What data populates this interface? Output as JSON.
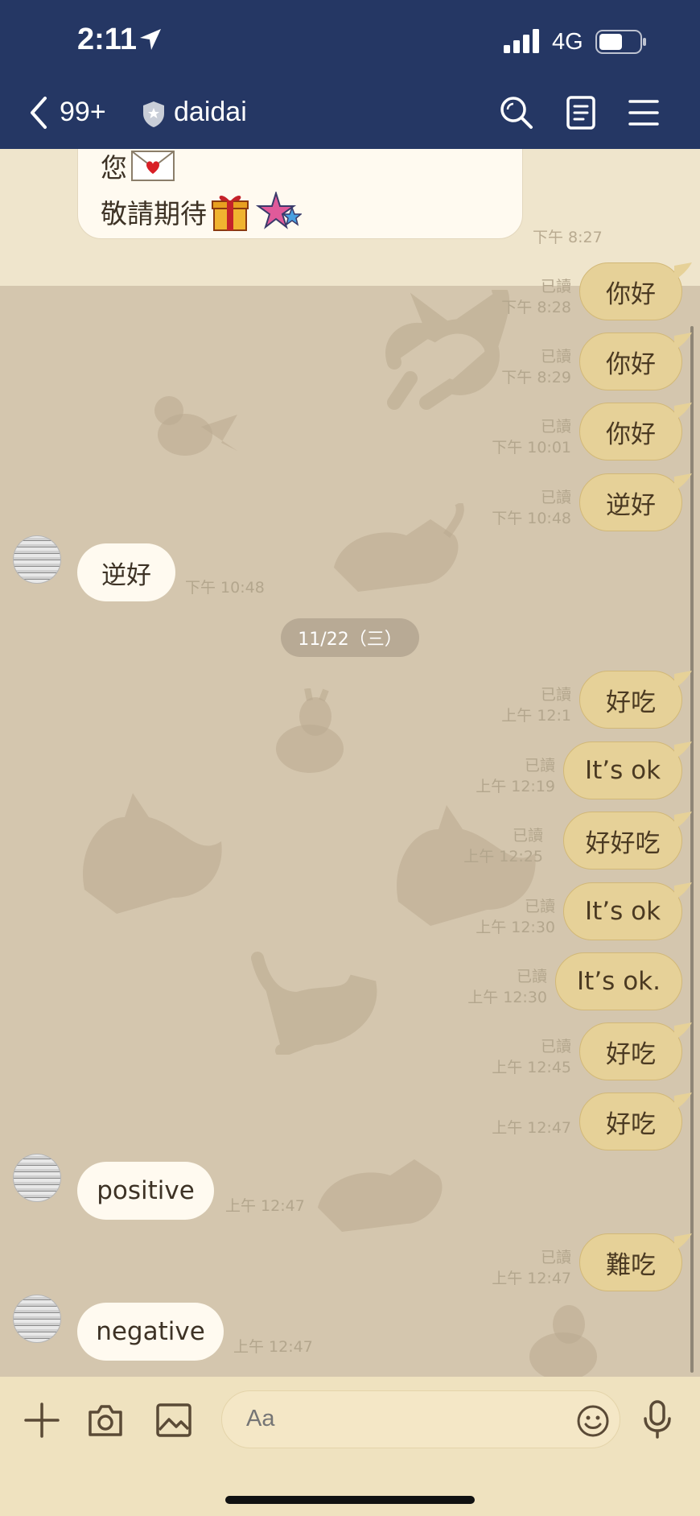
{
  "status_bar": {
    "time": "2:11",
    "network": "4G"
  },
  "nav": {
    "back_count": "99+",
    "title": "daidai"
  },
  "card": {
    "line1": "您",
    "line2": "敬請期待",
    "time": "下午 8:27"
  },
  "date_divider": "11/22（三）",
  "messages_out": [
    {
      "text": "你好",
      "read": "已讀",
      "time": "下午 8:28"
    },
    {
      "text": "你好",
      "read": "已讀",
      "time": "下午 8:29"
    },
    {
      "text": "你好",
      "read": "已讀",
      "time": "下午 10:01"
    },
    {
      "text": "逆好",
      "read": "已讀",
      "time": "下午 10:48"
    },
    {
      "text": "好吃",
      "read": "已讀",
      "time": "上午 12:1"
    },
    {
      "text": "It’s ok",
      "read": "已讀",
      "time": "上午 12:19"
    },
    {
      "text": "好好吃",
      "read": "已讀",
      "time": "上午 12:25"
    },
    {
      "text": "It’s ok",
      "read": "已讀",
      "time": "上午 12:30"
    },
    {
      "text": "It’s ok.",
      "read": "已讀",
      "time": "上午 12:30"
    },
    {
      "text": "好吃",
      "read": "已讀",
      "time": "上午 12:45"
    },
    {
      "text": "好吃",
      "read": "",
      "time": "上午 12:47"
    },
    {
      "text": "難吃",
      "read": "已讀",
      "time": "上午 12:47"
    }
  ],
  "messages_in": [
    {
      "text": "逆好",
      "time": "下午 10:48"
    },
    {
      "text": "positive",
      "time": "上午 12:47"
    },
    {
      "text": "negative",
      "time": "上午 12:47"
    }
  ],
  "input": {
    "placeholder": "Aa"
  },
  "icons": [
    "chevron-left-icon",
    "shield-icon",
    "search-icon",
    "notes-icon",
    "menu-icon",
    "plus-icon",
    "camera-icon",
    "image-icon",
    "emoji-icon",
    "microphone-icon",
    "location-arrow-icon",
    "signal-icon",
    "battery-icon",
    "envelope-heart-icon",
    "gift-icon",
    "star-icon"
  ],
  "colors": {
    "header": "#253764",
    "chat_bg": "#d4c6ae",
    "out_bubble": "#e6d198",
    "in_bubble": "#fffaf0",
    "bottom_bar": "#efe2bf"
  }
}
